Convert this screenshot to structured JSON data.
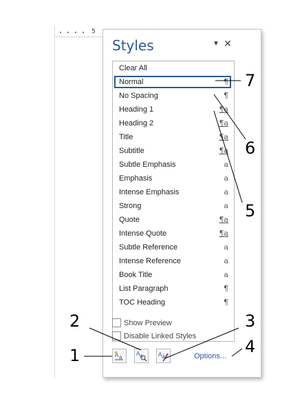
{
  "ruler": {
    "number": "5"
  },
  "pane": {
    "title": "Styles",
    "menu_glyph": "▼",
    "close_glyph": "✕"
  },
  "styles": [
    {
      "name": "Clear All",
      "glyph": ""
    },
    {
      "name": "Normal",
      "glyph": "¶",
      "selected": true
    },
    {
      "name": "No Spacing",
      "glyph": "¶"
    },
    {
      "name": "Heading 1",
      "glyph": "¶a",
      "linked": true
    },
    {
      "name": "Heading 2",
      "glyph": "¶a",
      "linked": true
    },
    {
      "name": "Title",
      "glyph": "¶a",
      "linked": true
    },
    {
      "name": "Subtitle",
      "glyph": "¶a",
      "linked": true
    },
    {
      "name": "Subtle Emphasis",
      "glyph": "a"
    },
    {
      "name": "Emphasis",
      "glyph": "a"
    },
    {
      "name": "Intense Emphasis",
      "glyph": "a"
    },
    {
      "name": "Strong",
      "glyph": "a"
    },
    {
      "name": "Quote",
      "glyph": "¶a",
      "linked": true
    },
    {
      "name": "Intense Quote",
      "glyph": "¶a",
      "linked": true
    },
    {
      "name": "Subtle Reference",
      "glyph": "a"
    },
    {
      "name": "Intense Reference",
      "glyph": "a"
    },
    {
      "name": "Book Title",
      "glyph": "a"
    },
    {
      "name": "List Paragraph",
      "glyph": "¶"
    },
    {
      "name": "TOC Heading",
      "glyph": "¶"
    }
  ],
  "options": {
    "show_preview": "Show Preview",
    "disable_linked": "Disable Linked Styles",
    "options_link": "Options..."
  },
  "buttons": {
    "new_style": "new-style-icon",
    "style_inspector": "style-inspector-icon",
    "manage_styles": "manage-styles-icon"
  },
  "callouts": [
    "1",
    "2",
    "3",
    "4",
    "5",
    "6",
    "7"
  ],
  "colors": {
    "accent": "#2b579a"
  }
}
